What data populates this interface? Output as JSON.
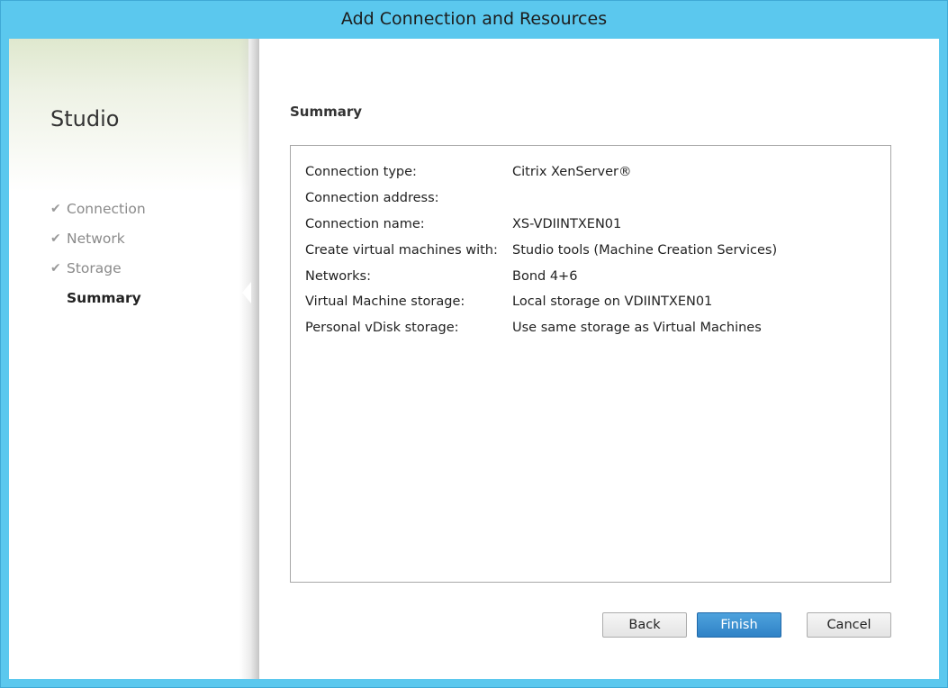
{
  "window": {
    "title": "Add Connection and Resources"
  },
  "sidebar": {
    "title": "Studio",
    "steps": [
      {
        "label": "Connection",
        "completed": true,
        "icon": "checkmark-icon"
      },
      {
        "label": "Network",
        "completed": true,
        "icon": "checkmark-icon"
      },
      {
        "label": "Storage",
        "completed": true,
        "icon": "checkmark-icon"
      },
      {
        "label": "Summary",
        "completed": false,
        "current": true
      }
    ]
  },
  "main": {
    "heading": "Summary",
    "rows": [
      {
        "label": "Connection type:",
        "value": "Citrix XenServer®"
      },
      {
        "label": "Connection address:",
        "value": ""
      },
      {
        "label": "Connection name:",
        "value": "XS-VDIINTXEN01"
      },
      {
        "label": "Create virtual machines with:",
        "value": "Studio tools (Machine Creation Services)"
      },
      {
        "label": "Networks:",
        "value": "Bond 4+6"
      },
      {
        "label": "Virtual Machine storage:",
        "value": "Local storage on VDIINTXEN01"
      },
      {
        "label": "Personal vDisk storage:",
        "value": "Use same storage as Virtual Machines"
      }
    ]
  },
  "buttons": {
    "back": "Back",
    "finish": "Finish",
    "cancel": "Cancel"
  },
  "colors": {
    "window_frame": "#5bc8ee",
    "primary_button": "#3a8fd2"
  }
}
